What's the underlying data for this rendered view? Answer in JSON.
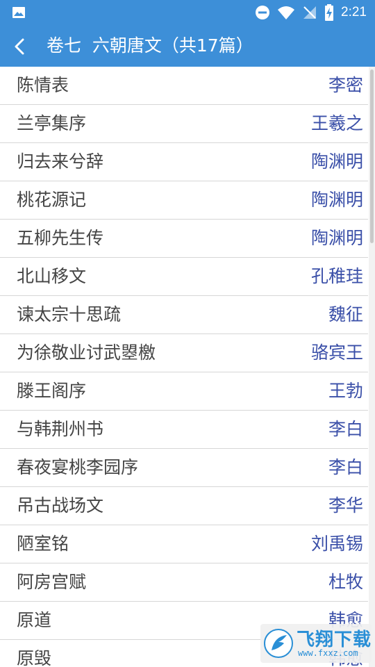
{
  "status_bar": {
    "time": "2:21",
    "icons": [
      "image-icon",
      "do-not-disturb-icon",
      "wifi-icon",
      "no-signal-icon",
      "battery-charging-icon"
    ]
  },
  "header": {
    "title": "卷七  六朝唐文（共17篇）",
    "back_icon": "back-arrow-icon"
  },
  "items": [
    {
      "title": "陈情表",
      "author": "李密"
    },
    {
      "title": "兰亭集序",
      "author": "王羲之"
    },
    {
      "title": "归去来兮辞",
      "author": "陶渊明"
    },
    {
      "title": "桃花源记",
      "author": "陶渊明"
    },
    {
      "title": "五柳先生传",
      "author": "陶渊明"
    },
    {
      "title": "北山移文",
      "author": "孔稚珪"
    },
    {
      "title": "谏太宗十思疏",
      "author": "魏征"
    },
    {
      "title": "为徐敬业讨武曌檄",
      "author": "骆宾王"
    },
    {
      "title": "滕王阁序",
      "author": "王勃"
    },
    {
      "title": "与韩荆州书",
      "author": "李白"
    },
    {
      "title": "春夜宴桃李园序",
      "author": "李白"
    },
    {
      "title": "吊古战场文",
      "author": "李华"
    },
    {
      "title": "陋室铭",
      "author": "刘禹锡"
    },
    {
      "title": "阿房宫赋",
      "author": "杜牧"
    },
    {
      "title": "原道",
      "author": "韩愈"
    },
    {
      "title": "原毁",
      "author": "韩愈"
    }
  ],
  "watermark": {
    "name": "飞翔下载",
    "url": "www.fxxz.com"
  },
  "colors": {
    "primary": "#3d8fd8",
    "author_text": "#3a4fa8",
    "title_text": "#444444",
    "divider": "#d6d6d6"
  }
}
